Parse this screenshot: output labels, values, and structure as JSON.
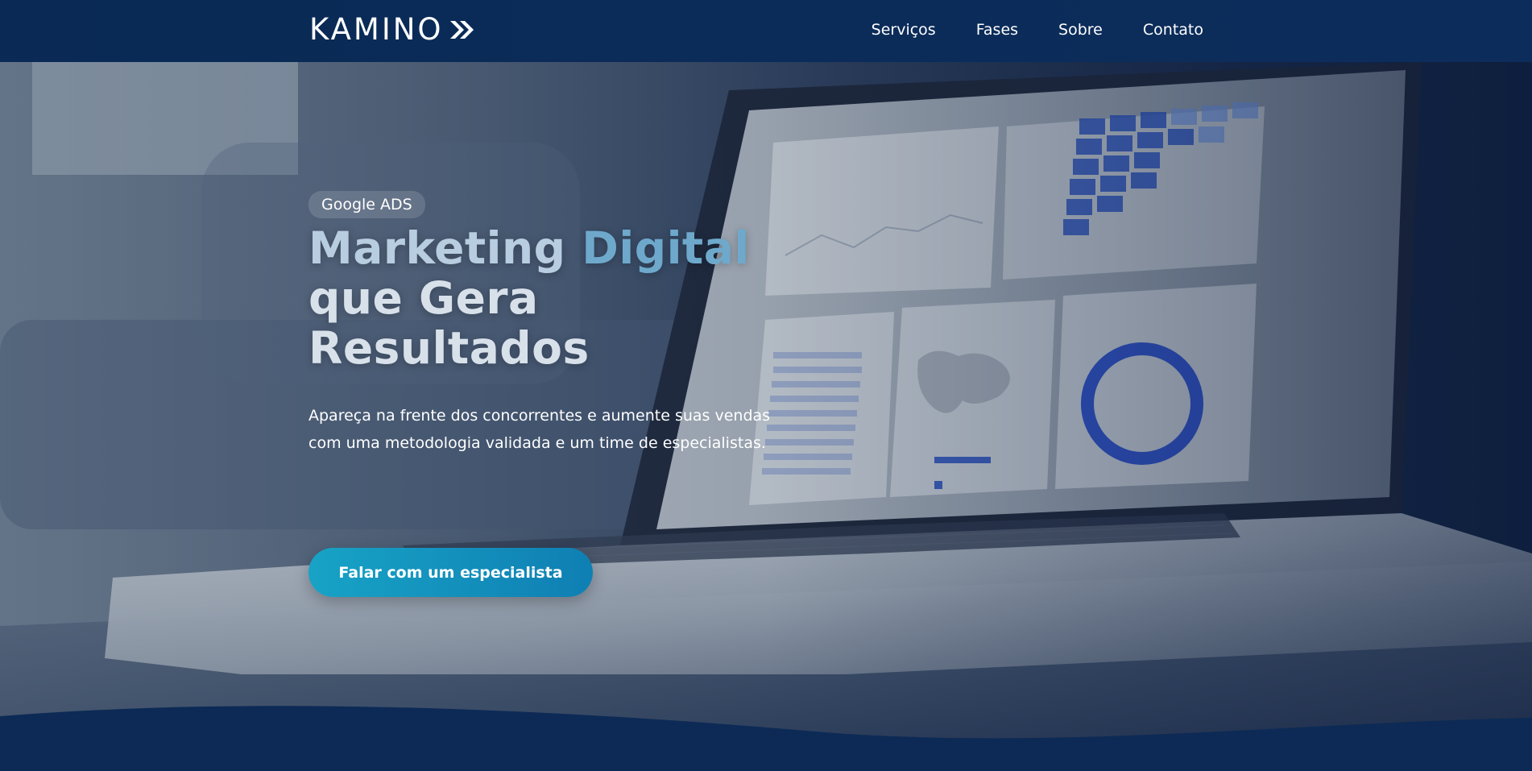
{
  "brand": {
    "logo_text": "KAMINO",
    "logo_icon": "double-chevron-right-icon"
  },
  "nav": {
    "items": [
      {
        "label": "Serviços"
      },
      {
        "label": "Fases"
      },
      {
        "label": "Sobre"
      },
      {
        "label": "Contato"
      }
    ]
  },
  "hero": {
    "badge": "Google ADS",
    "headline": {
      "line1_a": "Marketing ",
      "line1_b": "Digital",
      "line2": "que Gera",
      "line3": "Resultados"
    },
    "subtitle": "Apareça na frente dos concorrentes e aumente suas vendas com uma metodologia validada e um time de especialistas.",
    "cta_label": "Falar com um especialista"
  },
  "colors": {
    "header_bg": "#0c2d5c",
    "accent_blue": "#6ea9cc",
    "cta_gradient_start": "#17a3c6",
    "cta_gradient_end": "#0f7fb3",
    "wave": "#0c2a55"
  }
}
